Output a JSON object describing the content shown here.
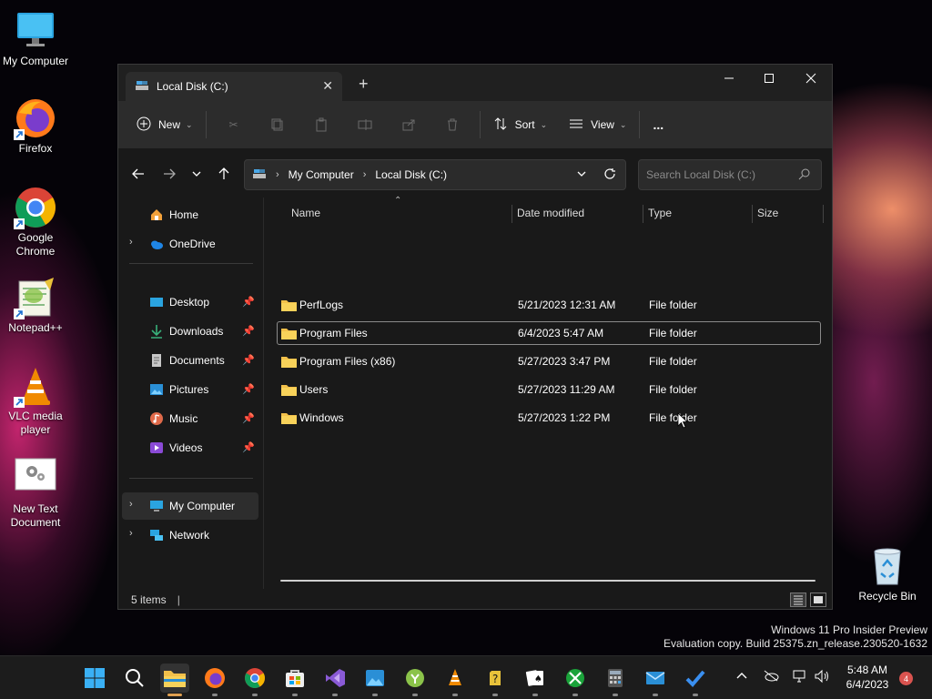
{
  "desktop": {
    "icons": [
      {
        "label": "My Computer"
      },
      {
        "label": "Firefox"
      },
      {
        "label": "Google Chrome"
      },
      {
        "label": "Notepad++"
      },
      {
        "label": "VLC media player"
      },
      {
        "label": "New Text Document"
      },
      {
        "label": "Recycle Bin"
      }
    ]
  },
  "window": {
    "tab_title": "Local Disk (C:)",
    "toolbar": {
      "new_label": "New",
      "sort_label": "Sort",
      "view_label": "View",
      "more_label": "..."
    },
    "address": {
      "crumbs": [
        "My Computer",
        "Local Disk (C:)"
      ]
    },
    "search": {
      "placeholder": "Search Local Disk (C:)"
    },
    "sidebar": {
      "items": [
        {
          "label": "Home"
        },
        {
          "label": "OneDrive"
        },
        {
          "label": "Desktop"
        },
        {
          "label": "Downloads"
        },
        {
          "label": "Documents"
        },
        {
          "label": "Pictures"
        },
        {
          "label": "Music"
        },
        {
          "label": "Videos"
        },
        {
          "label": "My Computer"
        },
        {
          "label": "Network"
        }
      ]
    },
    "columns": [
      "Name",
      "Date modified",
      "Type",
      "Size"
    ],
    "files": [
      {
        "name": "PerfLogs",
        "date": "5/21/2023 12:31 AM",
        "type": "File folder"
      },
      {
        "name": "Program Files",
        "date": "6/4/2023 5:47 AM",
        "type": "File folder"
      },
      {
        "name": "Program Files (x86)",
        "date": "5/27/2023 3:47 PM",
        "type": "File folder"
      },
      {
        "name": "Users",
        "date": "5/27/2023 11:29 AM",
        "type": "File folder"
      },
      {
        "name": "Windows",
        "date": "5/27/2023 1:22 PM",
        "type": "File folder"
      }
    ],
    "status": "5 items"
  },
  "watermark": {
    "line1": "Windows 11 Pro Insider Preview",
    "line2": "Evaluation copy. Build 25375.zn_release.230520-1632"
  },
  "taskbar": {
    "time": "5:48 AM",
    "date": "6/4/2023",
    "notification_count": "4"
  },
  "colors": {
    "accent": "#e0a050",
    "folder": "#f2c04a"
  }
}
